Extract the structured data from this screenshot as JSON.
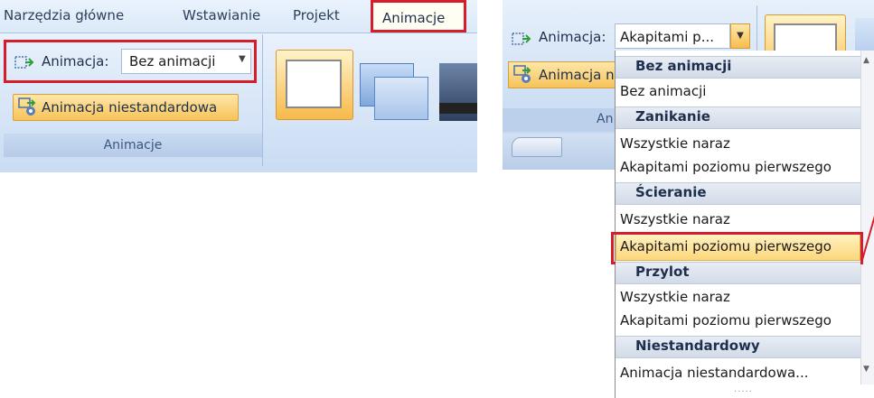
{
  "left": {
    "tabs": [
      "Narzędzia główne",
      "Wstawianie",
      "Projekt",
      "Animacje"
    ],
    "active_tab": "Animacje",
    "animation_label": "Animacja:",
    "animation_value": "Bez animacji",
    "custom_animation_label": "Animacja niestandardowa",
    "group_label": "Animacje"
  },
  "right": {
    "animation_label": "Animacja:",
    "animation_value": "Akapitami p...",
    "custom_animation_label_truncated": "Animacja n",
    "group_label_truncated": "An",
    "dropdown": [
      {
        "type": "header",
        "label": "Bez animacji"
      },
      {
        "type": "item",
        "label": "Bez animacji"
      },
      {
        "type": "header",
        "label": "Zanikanie"
      },
      {
        "type": "item",
        "label": "Wszystkie naraz"
      },
      {
        "type": "item",
        "label": "Akapitami poziomu pierwszego"
      },
      {
        "type": "header",
        "label": "Ścieranie"
      },
      {
        "type": "item",
        "label": "Wszystkie naraz"
      },
      {
        "type": "item",
        "label": "Akapitami poziomu pierwszego",
        "highlighted": true
      },
      {
        "type": "header",
        "label": "Przylot"
      },
      {
        "type": "item",
        "label": "Wszystkie naraz"
      },
      {
        "type": "item",
        "label": "Akapitami poziomu pierwszego"
      },
      {
        "type": "header",
        "label": "Niestandardowy"
      },
      {
        "type": "item",
        "label": "Animacja niestandardowa..."
      }
    ],
    "grip": "....."
  },
  "colors": {
    "highlight_red": "#d41e2b",
    "ribbon_blue": "#c9dcf3",
    "hover_orange": "#f7c35a"
  }
}
